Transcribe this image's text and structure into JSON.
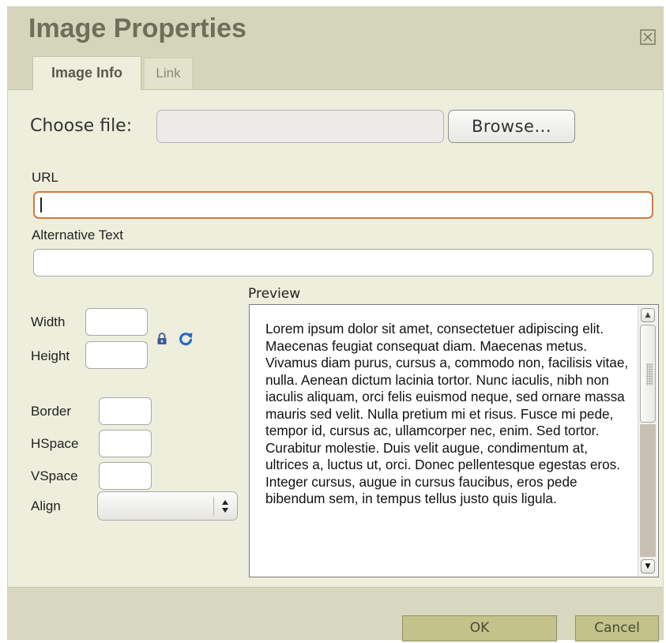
{
  "dialog": {
    "title": "Image Properties",
    "close_icon": "close-box-icon",
    "tabs": [
      {
        "label": "Image Info",
        "active": true
      },
      {
        "label": "Link",
        "active": false
      }
    ]
  },
  "file": {
    "label": "Choose file:",
    "value": "",
    "browse_label": "Browse..."
  },
  "url": {
    "label": "URL",
    "value": ""
  },
  "alt_text": {
    "label": "Alternative Text",
    "value": ""
  },
  "dimensions": {
    "width_label": "Width",
    "width_value": "",
    "height_label": "Height",
    "height_value": "",
    "lock_icon": "lock-icon",
    "reset_icon": "reset-size-icon"
  },
  "layout_fields": {
    "border_label": "Border",
    "border_value": "",
    "hspace_label": "HSpace",
    "hspace_value": "",
    "vspace_label": "VSpace",
    "vspace_value": "",
    "align_label": "Align",
    "align_value": ""
  },
  "preview": {
    "label": "Preview",
    "text": "Lorem ipsum dolor sit amet, consectetuer adipiscing elit. Maecenas feugiat consequat diam. Maecenas metus. Vivamus diam purus, cursus a, commodo non, facilisis vitae, nulla. Aenean dictum lacinia tortor. Nunc iaculis, nibh non iaculis aliquam, orci felis euismod neque, sed ornare massa mauris sed velit. Nulla pretium mi et risus. Fusce mi pede, tempor id, cursus ac, ullamcorper nec, enim. Sed tortor. Curabitur molestie. Duis velit augue, condimentum at, ultrices a, luctus ut, orci. Donec pellentesque egestas eros. Integer cursus, augue in cursus faucibus, eros pede bibendum sem, in tempus tellus justo quis ligula."
  },
  "footer": {
    "ok_label": "OK",
    "cancel_label": "Cancel"
  },
  "colors": {
    "dialog_bg": "#eeeedd",
    "header_bg": "#d5d5bc",
    "title_text": "#6f6f59",
    "focus_border": "#d07a3a",
    "button_bg": "#c2c28a",
    "lock_icon": "#3a5a9a",
    "reset_icon": "#2a6ac8"
  }
}
